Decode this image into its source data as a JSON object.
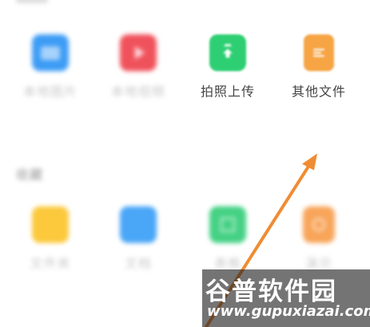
{
  "row1": {
    "tiles": [
      {
        "label": "本地图片",
        "icon": "image-icon",
        "color": "#3d9cf5"
      },
      {
        "label": "本地视频",
        "icon": "video-icon",
        "color": "#f0525c"
      },
      {
        "label": "拍照上传",
        "icon": "camera-upload-icon",
        "color": "#2ecf73"
      },
      {
        "label": "其他文件",
        "icon": "document-icon",
        "color": "#f6a444"
      }
    ]
  },
  "row2": {
    "title": "收藏",
    "tiles": [
      {
        "label": "文件夹",
        "icon": "folder-icon",
        "color": "#fcc93c"
      },
      {
        "label": "文档",
        "icon": "doc-icon",
        "color": "#4aa6f7"
      },
      {
        "label": "表格",
        "icon": "sheet-icon",
        "color": "#45d184"
      },
      {
        "label": "演示",
        "icon": "slides-icon",
        "color": "#f8a55a"
      }
    ]
  },
  "watermark": {
    "cn": "谷普软件园",
    "url": "www.gupuxiazai.com"
  },
  "colors": {
    "arrow": "#f08c33",
    "background": "#ffffff"
  }
}
